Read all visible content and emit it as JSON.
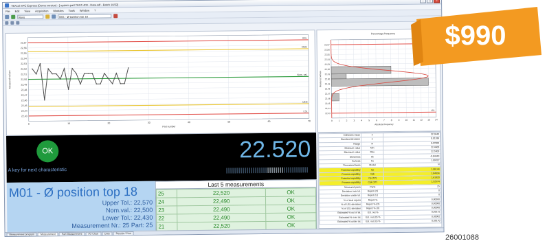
{
  "window": {
    "title": "TEXcol SPC Express (Demo version) - [ system part TEST-400 - Data.sdf - Batch 10/22]",
    "menu": [
      "File",
      "Edit",
      "View",
      "Acquisition",
      "Modules",
      "Tools",
      "Window",
      "?"
    ],
    "toolbar_field_1": "Boss",
    "toolbar_field_2": "M01 - Ø position top 18"
  },
  "run_chart": {
    "chart_data": {
      "type": "line",
      "title": "",
      "xlabel": "Part number",
      "ylabel": "Measured values",
      "xlim": [
        0,
        70
      ],
      "ylim": [
        22.42,
        22.58
      ],
      "x_ticks": [
        0,
        10,
        20,
        30,
        40,
        50,
        60,
        70
      ],
      "y_ticks": [
        22.43,
        22.44,
        22.45,
        22.46,
        22.47,
        22.48,
        22.49,
        22.5,
        22.51,
        22.52,
        22.53,
        22.54,
        22.55,
        22.56,
        22.57
      ],
      "series": [
        {
          "x": [
            1,
            2,
            3,
            4,
            5,
            6,
            7,
            8,
            9,
            10,
            11,
            12,
            13,
            14,
            15,
            16,
            17,
            18,
            19,
            20,
            21,
            22,
            23,
            24,
            25
          ],
          "y": [
            22.52,
            22.51,
            22.53,
            22.46,
            22.52,
            22.51,
            22.51,
            22.5,
            22.52,
            22.48,
            22.52,
            22.51,
            22.49,
            22.51,
            22.51,
            22.51,
            22.49,
            22.49,
            22.51,
            22.5,
            22.49,
            22.51,
            22.49,
            22.49,
            22.52
          ]
        }
      ],
      "reference_lines": [
        {
          "label": "USL",
          "value": 22.57,
          "color": "#e2504a"
        },
        {
          "label": "OEG",
          "value": 22.553,
          "color": "#e9c531"
        },
        {
          "label": "Nom. val.",
          "value": 22.5,
          "color": "#2a9a3a"
        },
        {
          "label": "UEG",
          "value": 22.448,
          "color": "#e9c531"
        },
        {
          "label": "LSL",
          "value": 22.43,
          "color": "#e2504a"
        }
      ],
      "grid": true
    }
  },
  "histogram": {
    "chart_data": {
      "type": "bar",
      "title": "Percentage frequency",
      "xlabel": "Absolute frequency",
      "ylabel": "Measured values",
      "xlim": [
        0,
        14
      ],
      "x_ticks": [
        0,
        1,
        2,
        3,
        4,
        5,
        6,
        7,
        8,
        9,
        10,
        11,
        12,
        13,
        14
      ],
      "ylim": [
        22.42,
        22.58
      ],
      "bins": [
        {
          "from": 22.51,
          "to": 22.525,
          "count": 8
        },
        {
          "from": 22.5,
          "to": 22.51,
          "count": 2
        },
        {
          "from": 22.485,
          "to": 22.5,
          "count": 13
        },
        {
          "from": 22.455,
          "to": 22.47,
          "count": 1
        }
      ],
      "reference_lines": [
        {
          "label": "USL",
          "value": 22.57,
          "color": "#e2504a"
        },
        {
          "label": "LSL",
          "value": 22.43,
          "color": "#e2504a"
        }
      ],
      "grid": true
    }
  },
  "result": {
    "status": "OK",
    "key_hint": "A key for next characteristic",
    "current_value": "22.520",
    "status_color": "#1f9a3c"
  },
  "characteristic": {
    "name": "M01 - Ø position top 18",
    "upper_tol": "Upper Tol.: 22,570",
    "nom_val": "Nom.val.: 22,500",
    "lower_tol": "Lower Tol.: 22,430",
    "measurement_nr": "Measurement Nr.: 25 Part: 25"
  },
  "last5": {
    "title": "Last 5 measurements",
    "rows": [
      {
        "nr": "25",
        "value": "22,520",
        "status": "OK"
      },
      {
        "nr": "24",
        "value": "22,490",
        "status": "OK"
      },
      {
        "nr": "23",
        "value": "22,490",
        "status": "OK"
      },
      {
        "nr": "22",
        "value": "22,490",
        "status": "OK"
      },
      {
        "nr": "21",
        "value": "22,520",
        "status": "OK"
      }
    ]
  },
  "statistics": {
    "rows": [
      {
        "label": "Arithmetic mean",
        "sym": "x̄",
        "value": "22,5040",
        "hl": false
      },
      {
        "label": "Standard deviation",
        "sym": "s",
        "value": "0,01189",
        "hl": false
      },
      {
        "label": "Range",
        "sym": "R",
        "value": "0,07000",
        "hl": false
      },
      {
        "label": "Minimum value",
        "sym": "Min",
        "value": "22,4600",
        "hl": false
      },
      {
        "label": "Maximum value",
        "sym": "Max",
        "value": "22,5300",
        "hl": false
      },
      {
        "label": "Skewness",
        "sym": "Sk",
        "value": "-0,84443",
        "hl": false
      },
      {
        "label": "Kurtosis",
        "sym": "Ku",
        "value": "1,09322",
        "hl": false
      },
      {
        "label": "Theoretical basis",
        "sym": "Model",
        "value": "N",
        "hl": false
      },
      {
        "label": "Potential capability",
        "sym": "Cp",
        "value": "1,96144",
        "hl": true
      },
      {
        "label": "Process capability",
        "sym": "Cpk",
        "value": "1,84934",
        "hl": true
      },
      {
        "label": "Potential capability",
        "sym": "Cp (ST)",
        "value": "1,61820",
        "hl": true
      },
      {
        "label": "Process capability",
        "sym": "Cpk (ST)",
        "value": "1,52574",
        "hl": true
      },
      {
        "label": "Measured parts",
        "sym": "Parts",
        "value": "25",
        "hl": false
      },
      {
        "label": "Deviation over tol.",
        "sym": "Reject (O)",
        "value": "0",
        "hl": false
      },
      {
        "label": "Deviation under tol.",
        "sym": "Reject (U)",
        "value": "0",
        "hl": false
      },
      {
        "label": "% of total rejects",
        "sym": "Reject %",
        "value": "0,00000",
        "hl": false
      },
      {
        "label": "% of USL deviation",
        "sym": "Reject % (O)",
        "value": "0,00000",
        "hl": false
      },
      {
        "label": "% of LSL deviation",
        "sym": "Reject % (U)",
        "value": "0,00000",
        "hl": false
      },
      {
        "label": "Estimated % out of tol.",
        "sym": "Est. out %",
        "value": "0,00172",
        "hl": false
      },
      {
        "label": "Estimated % over tol.",
        "sym": "Est. out (O) %",
        "value": "0,00002",
        "hl": false
      },
      {
        "label": "Estimated % under tol.",
        "sym": "Est. out (U) %",
        "value": "0,00170",
        "hl": false
      }
    ]
  },
  "tabs": [
    "Measurement program",
    "Measurement",
    "Part Measurement",
    "I/O Chart",
    "Data",
    "Results / Print"
  ],
  "banner": {
    "price": "$990",
    "color": "#f39a21"
  },
  "reference_number": "26001088"
}
